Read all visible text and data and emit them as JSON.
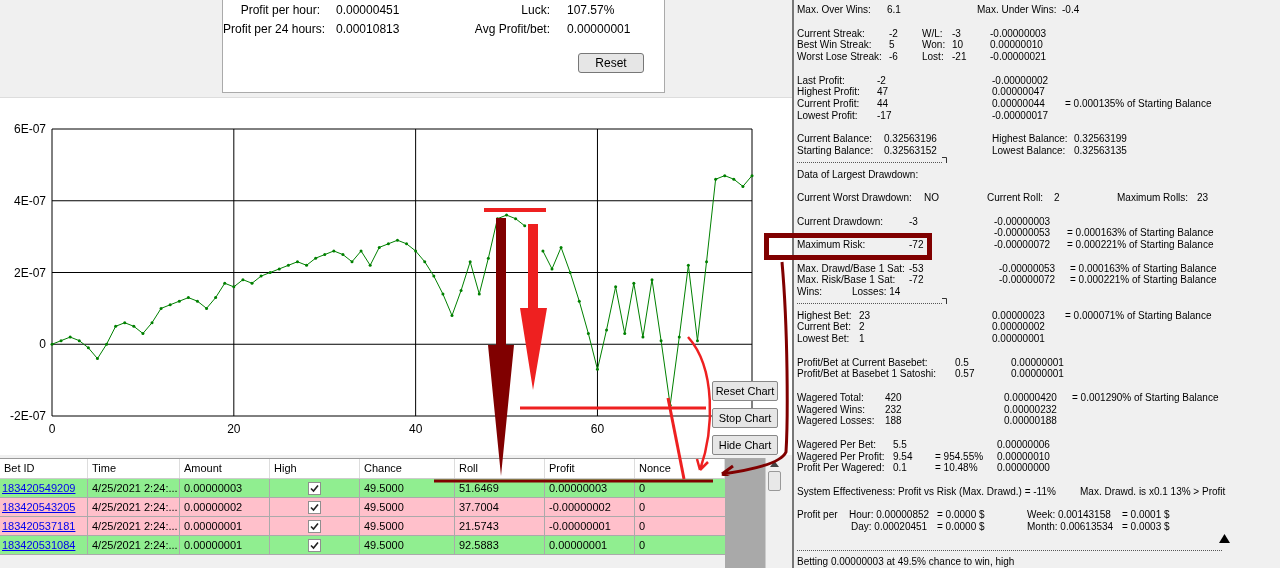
{
  "summary_panel": {
    "rows": [
      {
        "label": "Profit per hour:",
        "value": "0.00000451",
        "label_2": "Luck:",
        "value_2": "107.57%"
      },
      {
        "label": "Profit per 24 hours:",
        "value": "0.00010813",
        "label_2": "Avg Profit/bet:",
        "value_2": "0.00000001"
      }
    ],
    "reset_button": "Reset"
  },
  "chart": {
    "buttons": [
      "Reset Chart",
      "Stop Chart",
      "Hide Chart"
    ],
    "chart_data": {
      "type": "line",
      "grid": true,
      "xlim": [
        0,
        77
      ],
      "ylim": [
        -2e-07,
        6e-07
      ],
      "xticks": [
        0,
        20,
        40,
        60
      ],
      "yticks": [
        {
          "value": -2e-07,
          "label": "-2E-07"
        },
        {
          "value": 0,
          "label": "0"
        },
        {
          "value": 2e-07,
          "label": "2E-07"
        },
        {
          "value": 4e-07,
          "label": "4E-07"
        },
        {
          "value": 6e-07,
          "label": "6E-07"
        }
      ],
      "x": [
        0,
        1,
        2,
        3,
        4,
        5,
        6,
        7,
        8,
        9,
        10,
        11,
        12,
        13,
        14,
        15,
        16,
        17,
        18,
        19,
        20,
        21,
        22,
        23,
        24,
        25,
        26,
        27,
        28,
        29,
        30,
        31,
        32,
        33,
        34,
        35,
        36,
        37,
        38,
        39,
        40,
        41,
        42,
        43,
        44,
        45,
        46,
        47,
        48,
        49,
        50,
        51,
        52,
        53,
        54,
        55,
        56,
        57,
        58,
        59,
        60,
        61,
        62,
        63,
        64,
        65,
        66,
        67,
        68,
        69,
        70,
        71,
        72,
        73,
        74,
        75,
        76,
        77
      ],
      "series": [
        {
          "color": "#008000",
          "values": [
            0,
            1e-08,
            2e-08,
            1e-08,
            -1e-08,
            -4e-08,
            0,
            5e-08,
            6e-08,
            5e-08,
            3e-08,
            6e-08,
            1e-07,
            1.1e-07,
            1.2e-07,
            1.3e-07,
            1.2e-07,
            1e-07,
            1.3e-07,
            1.7e-07,
            1.6e-07,
            1.8e-07,
            1.7e-07,
            1.9e-07,
            2e-07,
            2.1e-07,
            2.2e-07,
            2.3e-07,
            2.2e-07,
            2.4e-07,
            2.5e-07,
            2.6e-07,
            2.5e-07,
            2.3e-07,
            2.6e-07,
            2.2e-07,
            2.7e-07,
            2.8e-07,
            2.9e-07,
            2.8e-07,
            2.6e-07,
            2.3e-07,
            1.9e-07,
            1.4e-07,
            8e-08,
            1.5e-07,
            2.3e-07,
            1.4e-07,
            2.4e-07,
            3.5e-07,
            3.6e-07,
            3.5e-07,
            3.3e-07,
            null,
            2.6e-07,
            2.1e-07,
            2.7e-07,
            2e-07,
            1.2e-07,
            3e-08,
            -7e-08,
            4e-08,
            1.6e-07,
            3e-08,
            1.7e-07,
            2e-08,
            1.8e-07,
            1e-08,
            -1.7e-07,
            2e-08,
            2.2e-07,
            1e-08,
            2.3e-07,
            4.6e-07,
            4.7e-07,
            4.6e-07,
            4.4e-07,
            4.7e-07
          ]
        }
      ]
    }
  },
  "bets_table": {
    "columns": [
      "Bet ID",
      "Time",
      "Amount",
      "High",
      "Chance",
      "Roll",
      "Profit",
      "Nonce"
    ],
    "rows": [
      {
        "bet_id": "183420549209",
        "time": "4/25/2021 2:24:...",
        "amount": "0.00000003",
        "high": true,
        "chance": "49.5000",
        "roll": "51.6469",
        "profit": "0.00000003",
        "nonce": "0",
        "color": "#90ee90"
      },
      {
        "bet_id": "183420543205",
        "time": "4/25/2021 2:24:...",
        "amount": "0.00000002",
        "high": true,
        "chance": "49.5000",
        "roll": "37.7004",
        "profit": "-0.00000002",
        "nonce": "0",
        "color": "#ffc0cb"
      },
      {
        "bet_id": "183420537181",
        "time": "4/25/2021 2:24:...",
        "amount": "0.00000001",
        "high": true,
        "chance": "49.5000",
        "roll": "21.5743",
        "profit": "-0.00000001",
        "nonce": "0",
        "color": "#ffc0cb"
      },
      {
        "bet_id": "183420531084",
        "time": "4/25/2021 2:24:...",
        "amount": "0.00000001",
        "high": true,
        "chance": "49.5000",
        "roll": "92.5883",
        "profit": "0.00000001",
        "nonce": "0",
        "color": "#90ee90"
      }
    ]
  },
  "stats_panel": {
    "lines": [
      {
        "kind": "pair",
        "cells": [
          "Max. Over Wins:",
          "6.1",
          "Max. Under Wins:",
          "-0.4"
        ]
      },
      {
        "kind": "blank"
      },
      {
        "kind": "streak",
        "cells": [
          "Current Streak:",
          "-2",
          "W/L:",
          "-3",
          "-0.00000003"
        ]
      },
      {
        "kind": "streak",
        "cells": [
          "Best Win Streak:",
          "5",
          "Won:",
          "10",
          "0.00000010"
        ]
      },
      {
        "kind": "streak",
        "cells": [
          "Worst Lose Streak:",
          "-6",
          "Lost:",
          "-21",
          "-0.00000021"
        ]
      },
      {
        "kind": "blank"
      },
      {
        "kind": "profit",
        "cells": [
          "Last Profit:",
          "-2",
          "-0.00000002"
        ]
      },
      {
        "kind": "profit",
        "cells": [
          "Highest Profit:",
          "47",
          "0.00000047"
        ]
      },
      {
        "kind": "profit",
        "cells": [
          "Current Profit:",
          "44",
          "0.00000044",
          "= 0.000135%  of  Starting Balance"
        ]
      },
      {
        "kind": "profit",
        "cells": [
          "Lowest Profit:",
          "-17",
          "-0.00000017"
        ]
      },
      {
        "kind": "blank"
      },
      {
        "kind": "balance",
        "cells": [
          "Current Balance:",
          "0.32563196",
          "Highest Balance:",
          "0.32563199"
        ]
      },
      {
        "kind": "balance",
        "cells": [
          "Starting Balance:",
          "0.32563152",
          "Lowest Balance:",
          "0.32563135"
        ]
      },
      {
        "kind": "divider"
      },
      {
        "kind": "text",
        "cells": [
          "Data of Largest Drawdown:"
        ]
      },
      {
        "kind": "blank"
      },
      {
        "kind": "rolls",
        "cells": [
          "Current Worst Drawdown:",
          "NO",
          "Current Roll:",
          "2",
          "Maximum Rolls:",
          "23"
        ]
      },
      {
        "kind": "blank"
      },
      {
        "kind": "drawdown",
        "cells": [
          "Current Drawdown:",
          "-3",
          "-0.00000003"
        ]
      },
      {
        "kind": "amounts",
        "cells": [
          "-0.00000053",
          "= 0.000163%  of  Starting Balance"
        ]
      },
      {
        "kind": "drawdown",
        "cells": [
          "Maximum Risk:",
          "-72",
          "-0.00000072",
          "= 0.000221%  of  Starting Balance"
        ]
      },
      {
        "kind": "blank"
      },
      {
        "kind": "sat",
        "cells": [
          "Max. Drawd/Base 1 Sat:",
          "-53",
          "-0.00000053",
          "= 0.000163%  of  Starting Balance"
        ]
      },
      {
        "kind": "sat",
        "cells": [
          "Max. Risk/Base 1 Sat:",
          "-72",
          "-0.00000072",
          "= 0.000221%  of  Starting Balance"
        ]
      },
      {
        "kind": "winloss",
        "cells": [
          "Wins:",
          "Losses:  14"
        ]
      },
      {
        "kind": "divider"
      },
      {
        "kind": "bet",
        "cells": [
          "Highest Bet:",
          "23",
          "0.00000023",
          "= 0.000071%  of  Starting Balance"
        ]
      },
      {
        "kind": "bet",
        "cells": [
          "Current Bet:",
          "2",
          "0.00000002"
        ]
      },
      {
        "kind": "bet",
        "cells": [
          "Lowest Bet:",
          "1",
          "0.00000001"
        ]
      },
      {
        "kind": "blank"
      },
      {
        "kind": "pbet",
        "cells": [
          "Profit/Bet at Current Basebet:",
          "0.5",
          "0.00000001"
        ]
      },
      {
        "kind": "pbet",
        "cells": [
          "Profit/Bet at Basebet 1 Satoshi:",
          "0.57",
          "0.00000001"
        ]
      },
      {
        "kind": "blank"
      },
      {
        "kind": "wager",
        "cells": [
          "Wagered Total:",
          "420",
          "0.00000420",
          "= 0.001290%  of  Starting Balance"
        ]
      },
      {
        "kind": "wager",
        "cells": [
          "Wagered Wins:",
          "232",
          "0.00000232"
        ]
      },
      {
        "kind": "wager",
        "cells": [
          "Wagered Losses:",
          "188",
          "0.00000188"
        ]
      },
      {
        "kind": "blank"
      },
      {
        "kind": "perbet",
        "cells": [
          "Wagered Per Bet:",
          "5.5",
          "0.00000006"
        ]
      },
      {
        "kind": "perbet3",
        "cells": [
          "Wagered Per Profit:",
          "9.54",
          "= 954.55%",
          "0.00000010"
        ]
      },
      {
        "kind": "perbet3",
        "cells": [
          "Profit Per Wagered:",
          "0.1",
          "= 10.48%",
          "0.00000000"
        ]
      },
      {
        "kind": "blank"
      },
      {
        "kind": "system",
        "cells": [
          "System Effectiveness:  Profit vs Risk (Max. Drawd.)  = -11%",
          "Max. Drawd. is x0.1  13%  >  Profit"
        ]
      },
      {
        "kind": "blank"
      },
      {
        "kind": "profitper",
        "cells": [
          "Profit per",
          "Hour: 0.00000852",
          "= 0.0000 $",
          "Week: 0.00143158",
          "= 0.0001 $"
        ]
      },
      {
        "kind": "profitper2",
        "cells": [
          "Day: 0.00020451",
          "= 0.0000 $",
          "Month: 0.00613534",
          "= 0.0003 $"
        ]
      },
      {
        "kind": "marker"
      },
      {
        "kind": "long_divider"
      },
      {
        "kind": "text",
        "cells": [
          "Betting 0.00000003 at 49.5% chance to win, high"
        ]
      }
    ]
  }
}
